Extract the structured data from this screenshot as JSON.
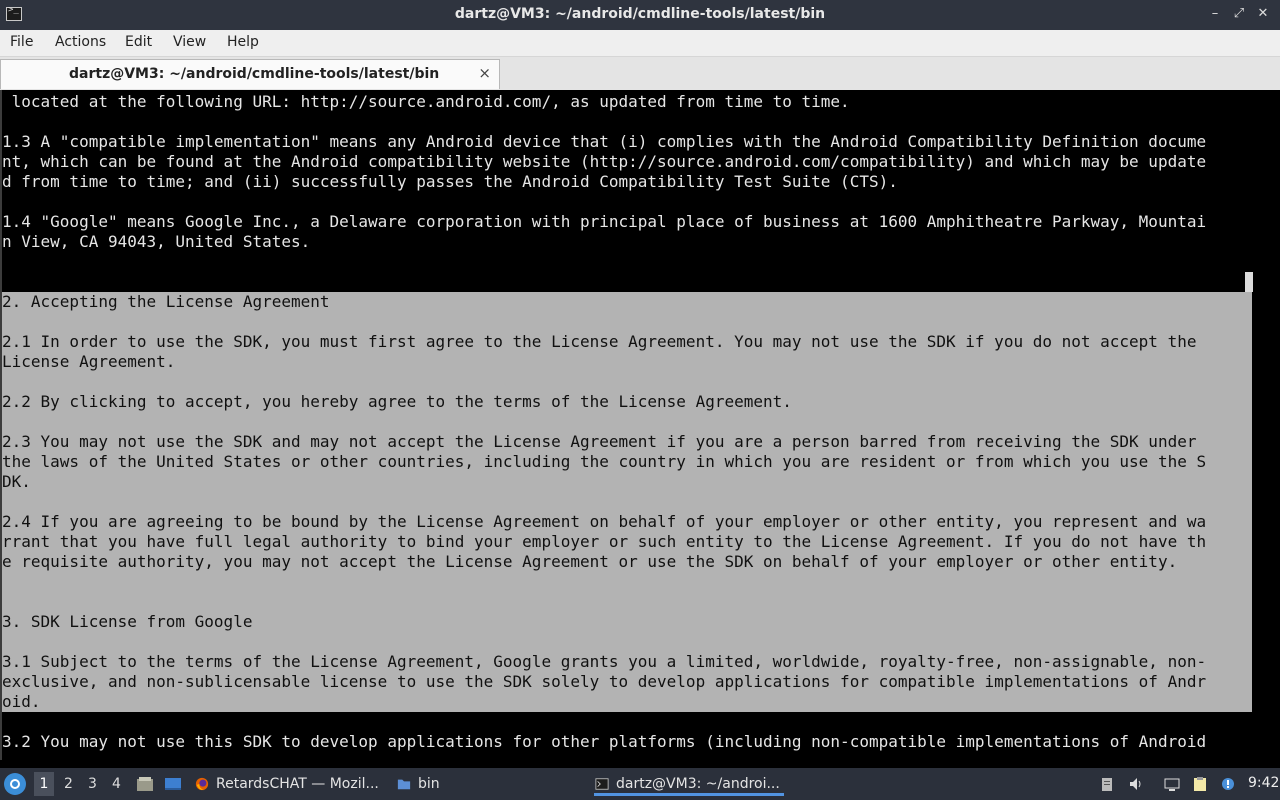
{
  "window": {
    "title": "dartz@VM3: ~/android/cmdline-tools/latest/bin"
  },
  "menubar": {
    "items": [
      "File",
      "Actions",
      "Edit",
      "View",
      "Help"
    ]
  },
  "tab": {
    "label": "dartz@VM3: ~/android/cmdline-tools/latest/bin",
    "close": "×"
  },
  "terminal": {
    "lines": [
      " located at the following URL: http://source.android.com/, as updated from time to time.",
      "",
      "1.3 A \"compatible implementation\" means any Android device that (i) complies with the Android Compatibility Definition docume",
      "nt, which can be found at the Android compatibility website (http://source.android.com/compatibility) and which may be update",
      "d from time to time; and (ii) successfully passes the Android Compatibility Test Suite (CTS).",
      "",
      "1.4 \"Google\" means Google Inc., a Delaware corporation with principal place of business at 1600 Amphitheatre Parkway, Mountai",
      "n View, CA 94043, United States.",
      "",
      "",
      "2. Accepting the License Agreement",
      "",
      "2.1 In order to use the SDK, you must first agree to the License Agreement. You may not use the SDK if you do not accept the",
      "License Agreement.",
      "",
      "2.2 By clicking to accept, you hereby agree to the terms of the License Agreement.",
      "",
      "2.3 You may not use the SDK and may not accept the License Agreement if you are a person barred from receiving the SDK under",
      "the laws of the United States or other countries, including the country in which you are resident or from which you use the S",
      "DK.",
      "",
      "2.4 If you are agreeing to be bound by the License Agreement on behalf of your employer or other entity, you represent and wa",
      "rrant that you have full legal authority to bind your employer or such entity to the License Agreement. If you do not have th",
      "e requisite authority, you may not accept the License Agreement or use the SDK on behalf of your employer or other entity.",
      "",
      "",
      "3. SDK License from Google",
      "",
      "3.1 Subject to the terms of the License Agreement, Google grants you a limited, worldwide, royalty-free, non-assignable, non-",
      "exclusive, and non-sublicensable license to use the SDK solely to develop applications for compatible implementations of Andr",
      "oid.",
      "",
      "3.2 You may not use this SDK to develop applications for other platforms (including non-compatible implementations of Android"
    ],
    "selection": {
      "first_line": 10,
      "last_line": 30
    }
  },
  "taskbar": {
    "workspaces": [
      "1",
      "2",
      "3",
      "4"
    ],
    "active_workspace": "1",
    "tasks": [
      {
        "label": "RetardsCHAT — Mozil...",
        "icon": "firefox-icon"
      },
      {
        "label": "bin",
        "icon": "folder-icon"
      },
      {
        "label": "dartz@VM3: ~/androi...",
        "icon": "terminal-icon",
        "active": true
      }
    ],
    "clock": "9:42"
  },
  "colors": {
    "titlebar": "#2f343f",
    "selection": "#b3b3b3",
    "taskbar": "#2b303b",
    "accent": "#5294e2"
  }
}
